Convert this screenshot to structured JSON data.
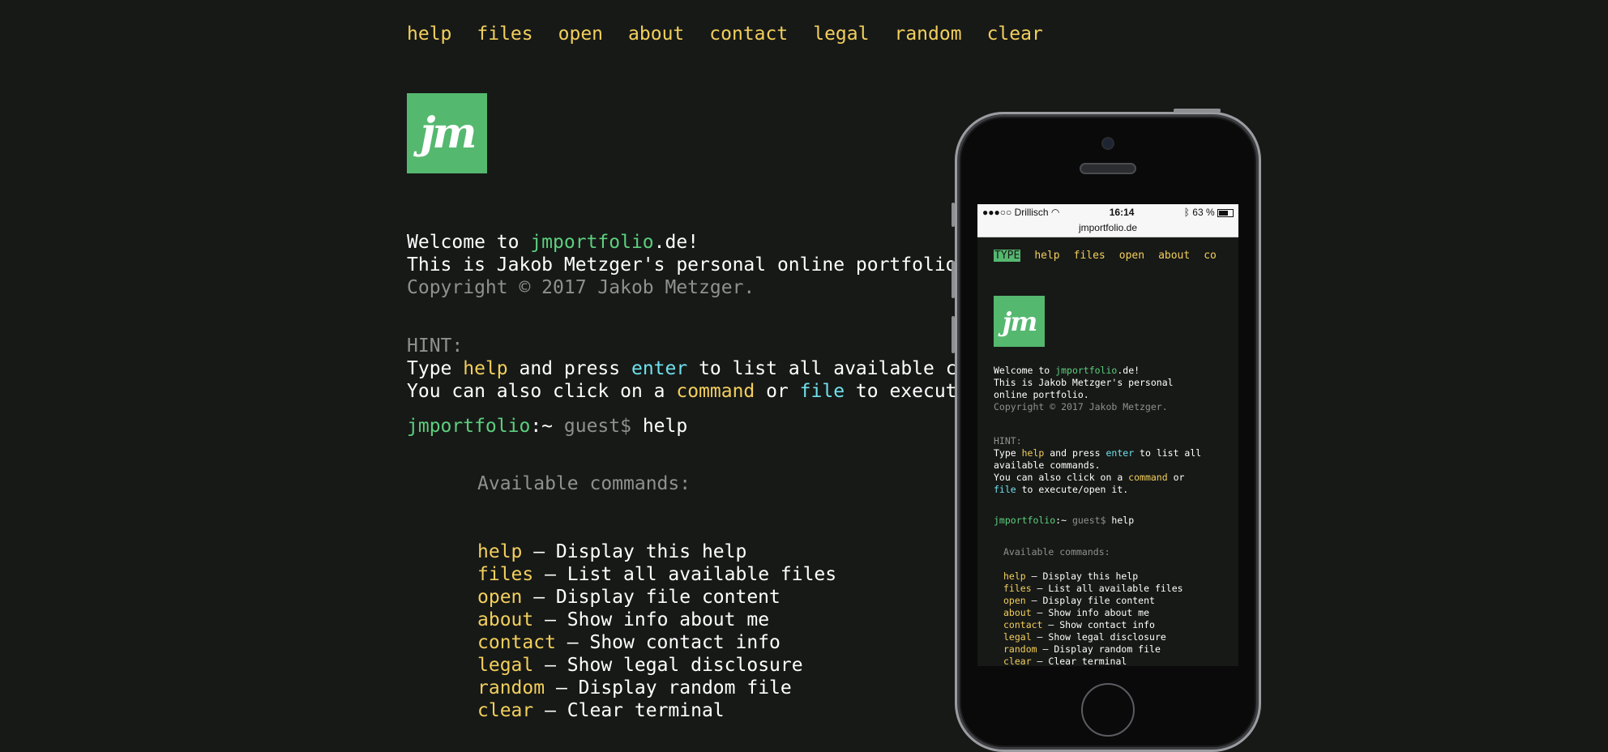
{
  "nav": [
    "help",
    "files",
    "open",
    "about",
    "contact",
    "legal",
    "random",
    "clear"
  ],
  "logo_text": "jm",
  "welcome": {
    "prefix": "Welcome to ",
    "site": "jmportfolio",
    "suffix": ".de!",
    "line2": "This is Jakob Metzger's personal online portfolio.",
    "copyright": "Copyright © 2017 Jakob Metzger."
  },
  "hint": {
    "title": "HINT:",
    "l1_a": "Type ",
    "l1_cmd": "help",
    "l1_b": " and press ",
    "l1_key": "enter",
    "l1_c": " to list all available comm",
    "l2_a": "You can also click on a ",
    "l2_cmd": "command",
    "l2_b": " or ",
    "l2_file": "file",
    "l2_c": " to execute/o"
  },
  "prompt": {
    "host": "jmportfolio",
    "path": ":~",
    "user": " guest$ ",
    "command": "help"
  },
  "available_title": "Available commands:",
  "commands": [
    {
      "name": "help",
      "desc": " – Display this help"
    },
    {
      "name": "files",
      "desc": " – List all available files"
    },
    {
      "name": "open",
      "desc": " – Display file content"
    },
    {
      "name": "about",
      "desc": " – Show info about me"
    },
    {
      "name": "contact",
      "desc": " – Show contact info"
    },
    {
      "name": "legal",
      "desc": " – Show legal disclosure"
    },
    {
      "name": "random",
      "desc": " – Display random file"
    },
    {
      "name": "clear",
      "desc": " – Clear terminal"
    }
  ],
  "phone": {
    "status": {
      "carrier": "●●●○○ Drillisch",
      "time": "16:14",
      "battery": "63 %"
    },
    "url": "jmportfolio.de",
    "nav": [
      "TYPE",
      "help",
      "files",
      "open",
      "about",
      "co"
    ],
    "logo_text": "jm",
    "welcome_prefix": "Welcome to ",
    "welcome_site": "jmportfolio",
    "welcome_suffix": ".de!",
    "line2": "This is Jakob Metzger's personal",
    "line3": "online portfolio.",
    "copyright": "Copyright © 2017 Jakob Metzger.",
    "hint_title": "HINT:",
    "hint_l1_a": "Type ",
    "hint_l1_cmd": "help",
    "hint_l1_b": " and press ",
    "hint_l1_key": "enter",
    "hint_l1_c": " to list all",
    "hint_l2": "available commands.",
    "hint_l3_a": "You can also click on a ",
    "hint_l3_cmd": "command",
    "hint_l3_b": " or",
    "hint_l4_file": "file",
    "hint_l4_b": " to execute/open it.",
    "prompt_host": "jmportfolio",
    "prompt_path": ":~",
    "prompt_user": " guest$ ",
    "prompt_cmd": "help",
    "available_title": "Available commands:",
    "commands": [
      {
        "name": "help",
        "desc": " – Display this help"
      },
      {
        "name": "files",
        "desc": " – List all available files"
      },
      {
        "name": "open",
        "desc": " – Display file content"
      },
      {
        "name": "about",
        "desc": " – Show info about me"
      },
      {
        "name": "contact",
        "desc": " – Show contact info"
      },
      {
        "name": "legal",
        "desc": " – Show legal disclosure"
      },
      {
        "name": "random",
        "desc": " – Display random file"
      },
      {
        "name": "clear",
        "desc": " – Clear terminal"
      }
    ]
  },
  "colors": {
    "background": "#171917",
    "command": "#f2cf5c",
    "key": "#6fe0ec",
    "host": "#5ccf7d",
    "muted": "#8f918d",
    "logo": "#55b86f"
  }
}
